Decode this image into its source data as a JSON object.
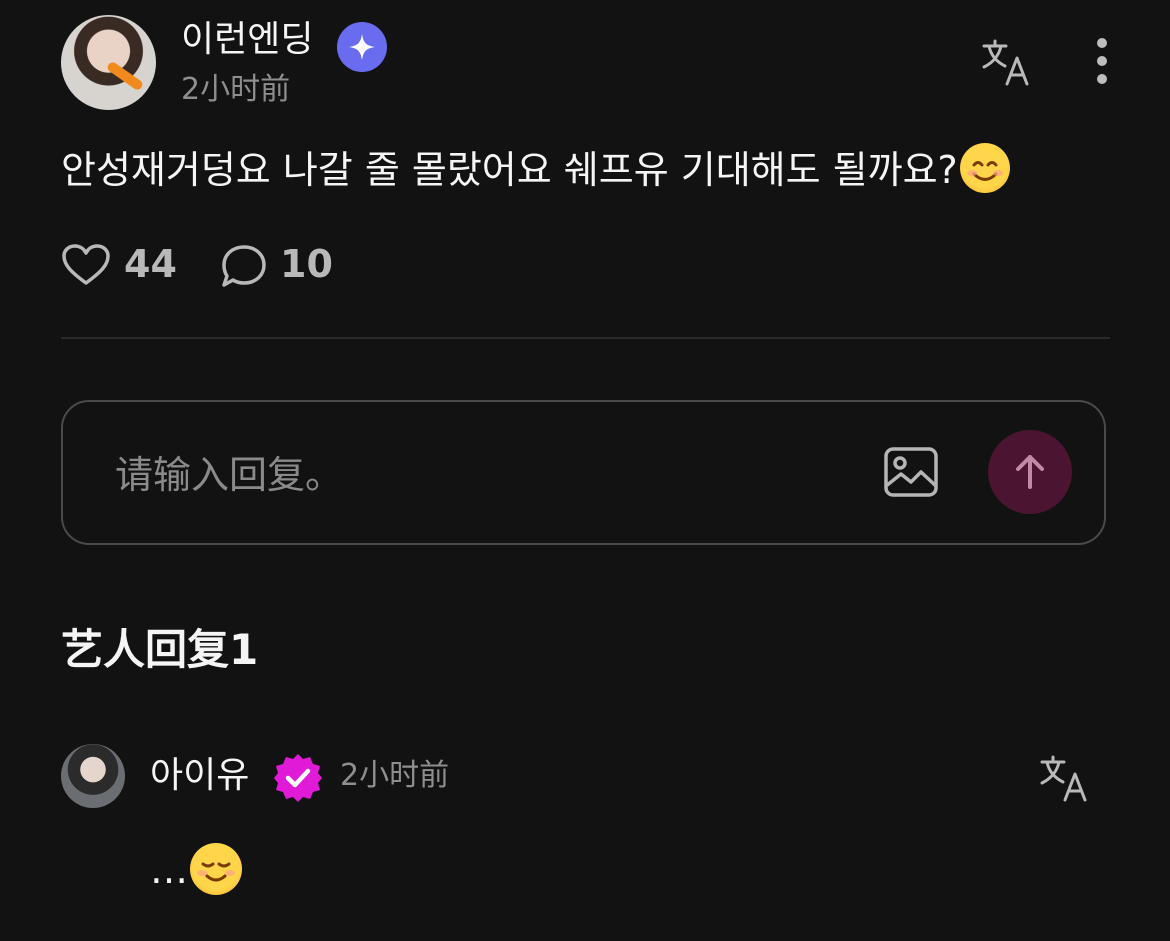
{
  "post": {
    "author_name": "이런엔딩",
    "time": "2小时前",
    "text": "안성재거덩요 나갈 줄 몰랐어요 쉐프유 기대해도 될까요?",
    "likes": "44",
    "comments": "10"
  },
  "reply_box": {
    "placeholder": "请输入回复。"
  },
  "artist_replies": {
    "title": "艺人回复1"
  },
  "comment": {
    "author_name": "아이유",
    "time": "2小时前",
    "text": "…"
  },
  "icons": {
    "badge_star": "sparkle-badge-icon",
    "verified": "verified-badge-icon",
    "translate": "translate-icon",
    "more": "more-vertical-icon",
    "like": "heart-icon",
    "comment": "comment-bubble-icon",
    "image": "image-icon",
    "send": "arrow-up-icon"
  },
  "colors": {
    "background": "#121212",
    "star_badge": "#6a6cf0",
    "verified_badge": "#e11ad8",
    "send_button": "#4b1430",
    "send_arrow": "#c28aa5"
  }
}
